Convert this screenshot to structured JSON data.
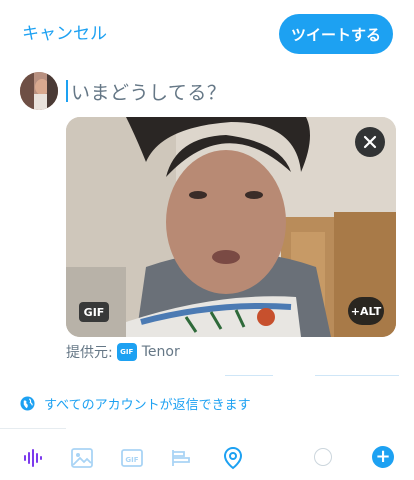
{
  "header": {
    "cancel_label": "キャンセル",
    "tweet_label": "ツイートする"
  },
  "compose": {
    "placeholder": "いまどうしてる？"
  },
  "media": {
    "gif_badge": "GIF",
    "alt_label": "+ALT"
  },
  "provider": {
    "prefix": "提供元:",
    "icon_text": "GIF",
    "name": "Tenor"
  },
  "reply_setting": {
    "label": "すべてのアカウントが返信できます"
  },
  "toolbar": {
    "icons": [
      "voice-icon",
      "image-icon",
      "gif-icon",
      "poll-icon",
      "location-icon"
    ],
    "plus_label": "+"
  },
  "colors": {
    "accent": "#1da1f2",
    "muted_icon": "#a9d4f5",
    "voice_icon": "#7c3aed"
  }
}
